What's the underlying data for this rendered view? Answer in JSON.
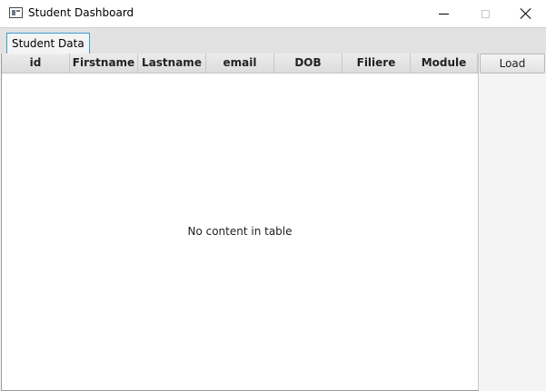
{
  "window": {
    "title": "Student Dashboard"
  },
  "tabs": [
    {
      "label": "Student Data",
      "selected": true
    }
  ],
  "table": {
    "columns": [
      "id",
      "Firstname",
      "Lastname",
      "email",
      "DOB",
      "Filiere",
      "Module"
    ],
    "rows": [],
    "placeholder": "No content in table"
  },
  "side_panel": {
    "load_label": "Load"
  },
  "colors": {
    "tab_focus_border": "#3c9fd6",
    "header_background": "#e2e2e2",
    "panel_background": "#f4f4f4"
  }
}
